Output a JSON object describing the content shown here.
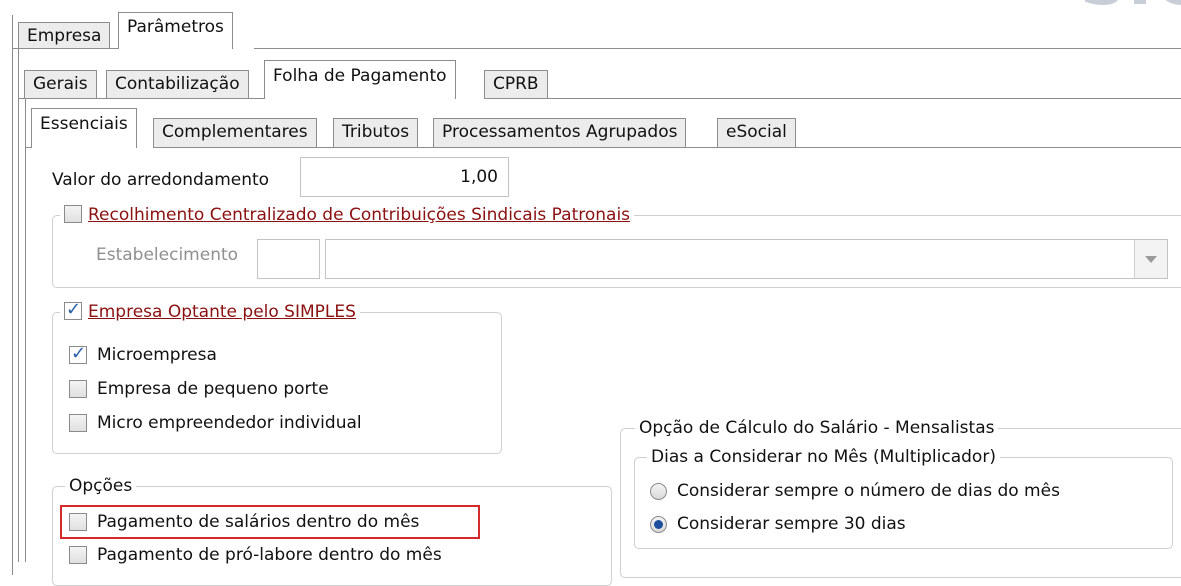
{
  "top_tabs": [
    "Empresa",
    "Parâmetros"
  ],
  "second_tabs": [
    "Gerais",
    "Contabilização",
    "Folha de Pagamento",
    "CPRB"
  ],
  "third_tabs": [
    "Essenciais",
    "Complementares",
    "Tributos",
    "Processamentos Agrupados",
    "eSocial"
  ],
  "rounding": {
    "label": "Valor do arredondamento",
    "value": "1,00"
  },
  "centralized": {
    "title": "Recolhimento Centralizado de Contribuições Sindicais Patronais",
    "checked": false,
    "establishment_label": "Estabelecimento",
    "establishment_code": "",
    "establishment_name": ""
  },
  "simples": {
    "title": "Empresa Optante pelo SIMPLES",
    "checked": true,
    "options": [
      {
        "label": "Microempresa",
        "checked": true
      },
      {
        "label": "Empresa de pequeno porte",
        "checked": false
      },
      {
        "label": "Micro empreendedor individual",
        "checked": false
      }
    ]
  },
  "opcoes": {
    "title": "Opções",
    "items": [
      {
        "label": "Pagamento de salários dentro do mês",
        "checked": false
      },
      {
        "label": "Pagamento de pró-labore dentro do mês",
        "checked": false
      }
    ]
  },
  "salary_calc": {
    "title": "Opção de Cálculo do Salário - Mensalistas",
    "subtitle": "Dias a Considerar no Mês (Multiplicador)",
    "options": [
      {
        "label": "Considerar sempre o número de dias do mês",
        "selected": false
      },
      {
        "label": "Considerar sempre 30 dias",
        "selected": true
      }
    ]
  },
  "colors": {
    "link": "#8b1010",
    "highlight": "#d62a2a",
    "radio_selected": "#1e4f9e"
  }
}
